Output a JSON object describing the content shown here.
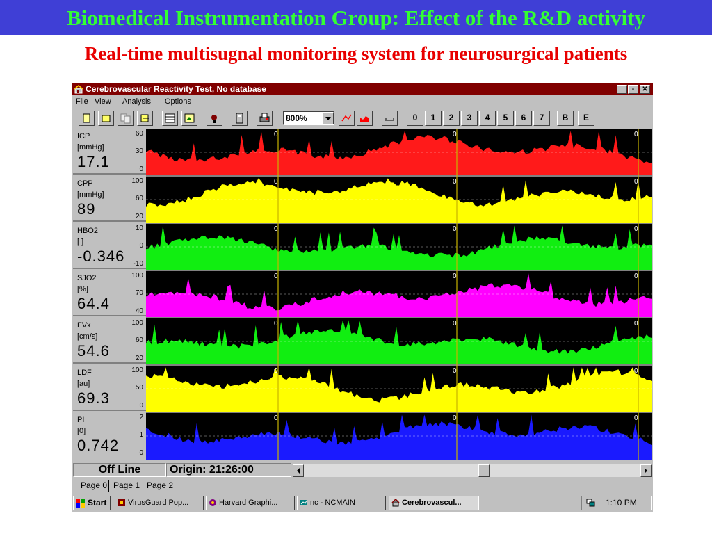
{
  "slide": {
    "title": "Biomedical Instrumentation Group: Effect of the R&D activity",
    "subtitle": "Real-time multisugnal monitoring system for neurosurgical patients"
  },
  "window": {
    "title": "Cerebrovascular Reactivity Test, No database",
    "controls": [
      "_",
      "▫",
      "✕"
    ]
  },
  "menu": [
    "File",
    "View",
    "Analysis",
    "Options"
  ],
  "toolbar": {
    "zoom_value": "800%",
    "page_buttons": [
      "0",
      "1",
      "2",
      "3",
      "4",
      "5",
      "6",
      "7"
    ],
    "letter_buttons": [
      "B",
      "E"
    ]
  },
  "panels": [
    {
      "name": "ICP",
      "unit": "[mmHg]",
      "value": "17.1",
      "ticks": [
        "60",
        "30",
        "0"
      ],
      "color": "#ff1a1a"
    },
    {
      "name": "CPP",
      "unit": "[mmHg]",
      "value": "89",
      "ticks": [
        "100",
        "60",
        "20"
      ],
      "color": "#ffff00"
    },
    {
      "name": "HBO2",
      "unit": "[ ]",
      "value": "-0.346",
      "ticks": [
        "10",
        "0",
        "-10"
      ],
      "color": "#11ee11"
    },
    {
      "name": "SJO2",
      "unit": "[%]",
      "value": "64.4",
      "ticks": [
        "100",
        "70",
        "40"
      ],
      "color": "#ff00ff"
    },
    {
      "name": "FVx",
      "unit": "[cm/s]",
      "value": "54.6",
      "ticks": [
        "100",
        "60",
        "20"
      ],
      "color": "#11ee11"
    },
    {
      "name": "LDF",
      "unit": "[au]",
      "value": "69.3",
      "ticks": [
        "100",
        "50",
        "0"
      ],
      "color": "#ffff00"
    },
    {
      "name": "PI",
      "unit": "[0]",
      "value": "0.742",
      "ticks": [
        "2",
        "1",
        "0"
      ],
      "color": "#1a1aff"
    }
  ],
  "marker_label": "0",
  "status": {
    "mode": "Off Line",
    "origin": "Origin: 21:26:00"
  },
  "tabs": [
    "Page 0",
    "Page 1",
    "Page 2"
  ],
  "taskbar": {
    "start": "Start",
    "tasks": [
      "VirusGuard Pop...",
      "Harvard Graphi...",
      "nc - NCMAIN",
      "Cerebrovascul..."
    ],
    "clock": "1:10 PM"
  }
}
